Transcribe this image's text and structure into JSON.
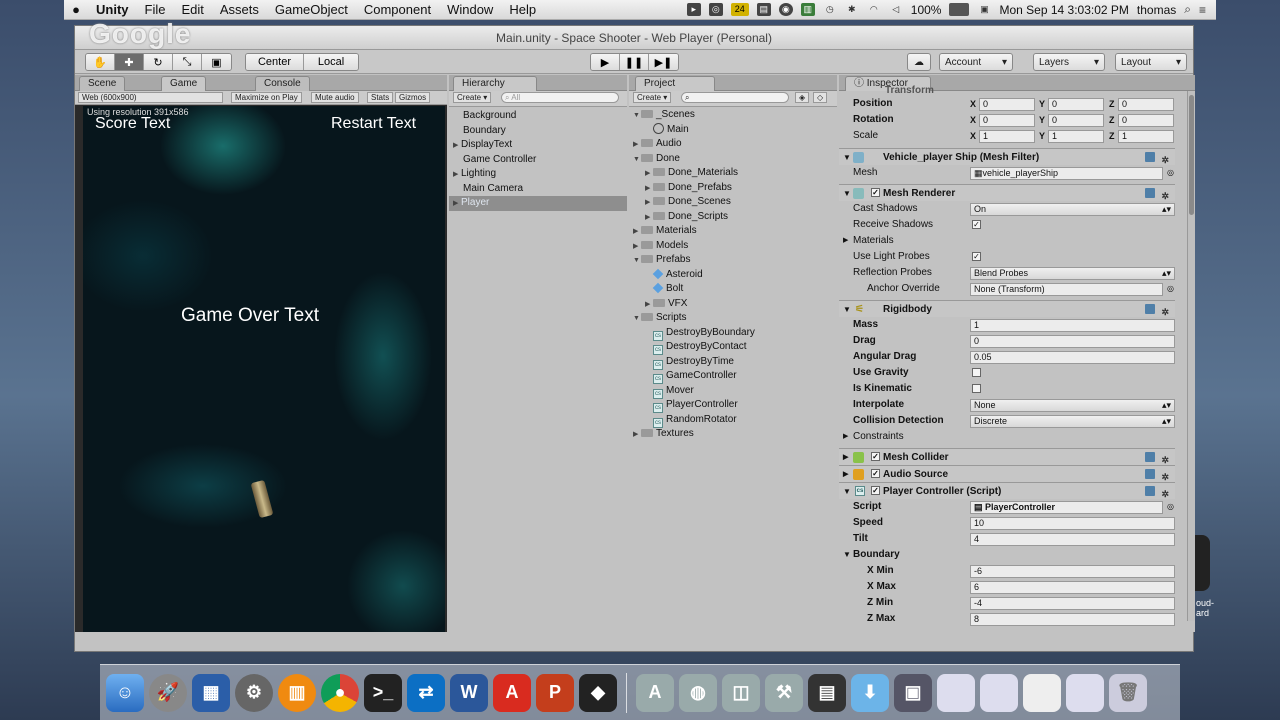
{
  "menubar": {
    "apple": "",
    "items": [
      "Unity",
      "File",
      "Edit",
      "Assets",
      "GameObject",
      "Component",
      "Window",
      "Help"
    ],
    "status": {
      "battery": "100%",
      "clock": "Mon Sep 14  3:03:02 PM",
      "user": "thomas",
      "badge": "24"
    }
  },
  "window": {
    "title": "Main.unity - Space Shooter - Web Player (Personal)",
    "watermark": "Google"
  },
  "toolbar": {
    "pivot": "Center",
    "space": "Local",
    "account": "Account",
    "layers": "Layers",
    "layout": "Layout"
  },
  "scene_panel": {
    "tabs": [
      "Scene",
      "Game",
      "Console"
    ],
    "resolution": "Web (600x900)",
    "options": [
      "Maximize on Play",
      "Mute audio",
      "Stats",
      "Gizmos"
    ],
    "res_info": "Using resolution 391x586",
    "game_texts": {
      "score": "Score Text",
      "restart": "Restart Text",
      "gameover": "Game Over Text"
    }
  },
  "hierarchy": {
    "tab": "Hierarchy",
    "create": "Create",
    "search": "All",
    "items": [
      "Background",
      "Boundary",
      "DisplayText",
      "Game Controller",
      "Lighting",
      "Main Camera",
      "Player"
    ]
  },
  "project": {
    "tab": "Project",
    "create": "Create",
    "items": [
      {
        "label": "_Scenes",
        "kind": "folder",
        "depth": 0,
        "open": true
      },
      {
        "label": "Main",
        "kind": "unity",
        "depth": 1
      },
      {
        "label": "Audio",
        "kind": "folder",
        "depth": 0
      },
      {
        "label": "Done",
        "kind": "folder",
        "depth": 0,
        "open": true
      },
      {
        "label": "Done_Materials",
        "kind": "folder",
        "depth": 1
      },
      {
        "label": "Done_Prefabs",
        "kind": "folder",
        "depth": 1
      },
      {
        "label": "Done_Scenes",
        "kind": "folder",
        "depth": 1
      },
      {
        "label": "Done_Scripts",
        "kind": "folder",
        "depth": 1
      },
      {
        "label": "Materials",
        "kind": "folder",
        "depth": 0
      },
      {
        "label": "Models",
        "kind": "folder",
        "depth": 0
      },
      {
        "label": "Prefabs",
        "kind": "folder",
        "depth": 0,
        "open": true
      },
      {
        "label": "Asteroid",
        "kind": "prefab",
        "depth": 1
      },
      {
        "label": "Bolt",
        "kind": "prefab",
        "depth": 1
      },
      {
        "label": "VFX",
        "kind": "folder",
        "depth": 1
      },
      {
        "label": "Scripts",
        "kind": "folder",
        "depth": 0,
        "open": true
      },
      {
        "label": "DestroyByBoundary",
        "kind": "script",
        "depth": 1
      },
      {
        "label": "DestroyByContact",
        "kind": "script",
        "depth": 1
      },
      {
        "label": "DestroyByTime",
        "kind": "script",
        "depth": 1
      },
      {
        "label": "GameController",
        "kind": "script",
        "depth": 1
      },
      {
        "label": "Mover",
        "kind": "script",
        "depth": 1
      },
      {
        "label": "PlayerController",
        "kind": "script",
        "depth": 1
      },
      {
        "label": "RandomRotator",
        "kind": "script",
        "depth": 1
      },
      {
        "label": "Textures",
        "kind": "folder",
        "depth": 0
      }
    ]
  },
  "inspector": {
    "tab": "Inspector",
    "transform_header": "Transform",
    "position": {
      "label": "Position",
      "x": "0",
      "y": "0",
      "z": "0"
    },
    "rotation": {
      "label": "Rotation",
      "x": "0",
      "y": "0",
      "z": "0"
    },
    "scale": {
      "label": "Scale",
      "x": "1",
      "y": "1",
      "z": "1"
    },
    "axis": {
      "x": "X",
      "y": "Y",
      "z": "Z"
    },
    "mesh_filter": {
      "header": "Vehicle_player Ship (Mesh Filter)",
      "mesh_label": "Mesh",
      "mesh_value": "vehicle_playerShip"
    },
    "mesh_renderer": {
      "header": "Mesh Renderer",
      "cast_shadows": "Cast Shadows",
      "cast_value": "On",
      "receive": "Receive Shadows",
      "materials": "Materials",
      "light_probes": "Use Light Probes",
      "reflection": "Reflection Probes",
      "reflection_value": "Blend Probes",
      "anchor": "Anchor Override",
      "anchor_value": "None (Transform)"
    },
    "rigidbody": {
      "header": "Rigidbody",
      "mass": "Mass",
      "mass_v": "1",
      "drag": "Drag",
      "drag_v": "0",
      "angular": "Angular Drag",
      "angular_v": "0.05",
      "gravity": "Use Gravity",
      "kinematic": "Is Kinematic",
      "interpolate": "Interpolate",
      "interpolate_v": "None",
      "collision": "Collision Detection",
      "collision_v": "Discrete",
      "constraints": "Constraints"
    },
    "mesh_collider": "Mesh Collider",
    "audio_source": "Audio Source",
    "player_controller": {
      "header": "Player Controller (Script)",
      "script": "Script",
      "script_v": "PlayerController",
      "speed": "Speed",
      "speed_v": "10",
      "tilt": "Tilt",
      "tilt_v": "4",
      "boundary": "Boundary",
      "xmin": "X Min",
      "xmin_v": "-6",
      "xmax": "X Max",
      "xmax_v": "6",
      "zmin": "Z Min",
      "zmin_v": "-4",
      "zmax": "Z Max",
      "zmax_v": "8"
    }
  },
  "desktop_labels": {
    "label1": "oud-",
    "label2": "ard"
  }
}
